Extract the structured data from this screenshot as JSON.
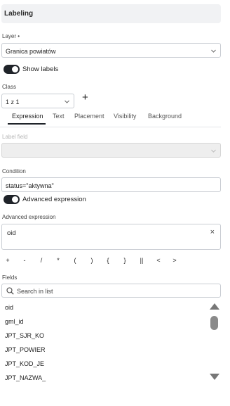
{
  "panel": {
    "title": "Labeling"
  },
  "layer": {
    "label": "Layer •",
    "value": "Granica powiatów",
    "show_labels_toggle": "on",
    "show_labels_text": "Show labels"
  },
  "class": {
    "label": "Class",
    "value": "1 z 1",
    "add_symbol": "+"
  },
  "tabs": [
    "Expression",
    "Text",
    "Placement",
    "Visibility",
    "Background"
  ],
  "active_tab": "Expression",
  "label_field": {
    "label": "Label field",
    "value": ""
  },
  "condition": {
    "label": "Condition",
    "value": "status=\"aktywna\""
  },
  "advanced": {
    "toggle": "on",
    "toggle_text": "Advanced expression",
    "field_label": "Advanced expression",
    "value": "oid",
    "clear_symbol": "×"
  },
  "operators": [
    "+",
    "-",
    "/",
    "*",
    "(",
    ")",
    "{",
    "}",
    "||",
    "<",
    ">"
  ],
  "fields": {
    "label": "Fields",
    "search_placeholder": "Search in list",
    "items": [
      "oid",
      "gml_id",
      "JPT_SJR_KO",
      "JPT_POWIER",
      "JPT_KOD_JE",
      "JPT_NAZWA_"
    ]
  },
  "colors": {
    "toggle_on": "#1f2329",
    "header_bg": "#f1f2f4",
    "border": "#c9cdd3"
  },
  "icons": {
    "search": "magnifier-icon",
    "dropdown": "chevron-down-icon",
    "clear": "close-icon"
  }
}
